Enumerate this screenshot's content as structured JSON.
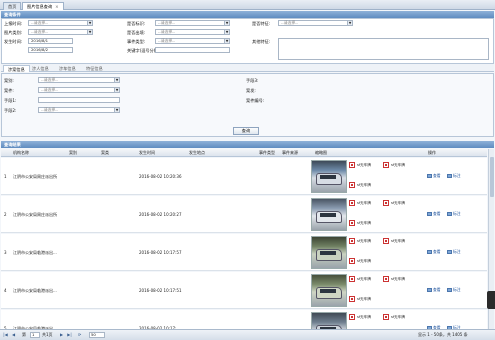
{
  "tabs": [
    {
      "label": "首页"
    },
    {
      "label": "图片信息查询",
      "close": "×"
    }
  ],
  "query": {
    "header": "查询条件",
    "fields": [
      {
        "label": "上报时间:",
        "value": "--请选择--"
      },
      {
        "label": "图片类别:",
        "value": "--请选择--"
      },
      {
        "label": "发生时间:",
        "value": "2016/8/1"
      },
      {
        "label": "",
        "value": "2016/8/2"
      },
      {
        "label": "是否标识:",
        "value": "--请选择--"
      },
      {
        "label": "是否出境:",
        "value": "--请选择--"
      },
      {
        "label": "事件类型:",
        "value": "--请选择--"
      },
      {
        "label": "关键字(逗号分隔):",
        "value": ""
      },
      {
        "label": "是否特征:",
        "value": "--请选择--"
      },
      {
        "label": "其他特征:",
        "value": ""
      }
    ],
    "subtabs": [
      "涉案信息",
      "涉人信息",
      "涉车信息",
      "特征信息"
    ],
    "case_fields": [
      {
        "label": "案别:",
        "value": "--请选择--"
      },
      {
        "label": "案件:",
        "value": "--请选择--"
      },
      {
        "label": "手段1:",
        "value": ""
      },
      {
        "label": "手段2:",
        "value": "--请选择--"
      },
      {
        "label": "手段3:",
        "value": ""
      },
      {
        "label": "案发:",
        "value": ""
      },
      {
        "label": "案件编号:",
        "value": ""
      }
    ],
    "query_button": "查询"
  },
  "results": {
    "header": "查询结果",
    "columns": [
      "机构名称",
      "案别",
      "案类",
      "发生时间",
      "发生地点",
      "事件类型",
      "事件来源",
      "缩略图",
      "操作"
    ],
    "rows": [
      {
        "num": "1",
        "org": "江阴市公安局周庄派出所",
        "time": "2016-08-02 10:20:36",
        "plates": [
          "sf无车牌",
          "sf无车牌",
          "sf无车牌"
        ],
        "ops": [
          "查看",
          "标注"
        ]
      },
      {
        "num": "2",
        "org": "江阴市公安局周庄派出所",
        "time": "2016-08-02 10:20:27",
        "plates": [
          "sf无车牌",
          "sf无车牌",
          "sf无车牌"
        ],
        "ops": [
          "查看",
          "标注"
        ]
      },
      {
        "num": "3",
        "org": "江阴市公安局临港派出... ",
        "time": "2016-08-02 10:17:57",
        "plates": [
          "sf无车牌",
          "sf无车牌",
          "sf无车牌"
        ],
        "ops": [
          "查看",
          "标注"
        ]
      },
      {
        "num": "4",
        "org": "江阴市公安局临港派出... ",
        "time": "2016-08-02 10:17:51",
        "plates": [
          "sf无车牌",
          "sf无车牌",
          "sf无车牌"
        ],
        "ops": [
          "查看",
          "标注"
        ]
      },
      {
        "num": "5",
        "org": "江阴市公安局临港派出... ",
        "time": "2016-08-02 10:17:...",
        "plates": [
          "sf无车牌",
          "sf无车牌",
          "sf无车牌"
        ],
        "ops": [
          "查看",
          "标注"
        ]
      }
    ]
  },
  "pager": {
    "first": "|◀",
    "prev": "◀",
    "page_label_pre": "第",
    "page_value": "1",
    "page_label_post": "共1页",
    "next": "▶",
    "last": "▶|",
    "refresh": "⟳",
    "page_size": "50",
    "summary": "显示 1 - 50条，共 1405 条"
  }
}
